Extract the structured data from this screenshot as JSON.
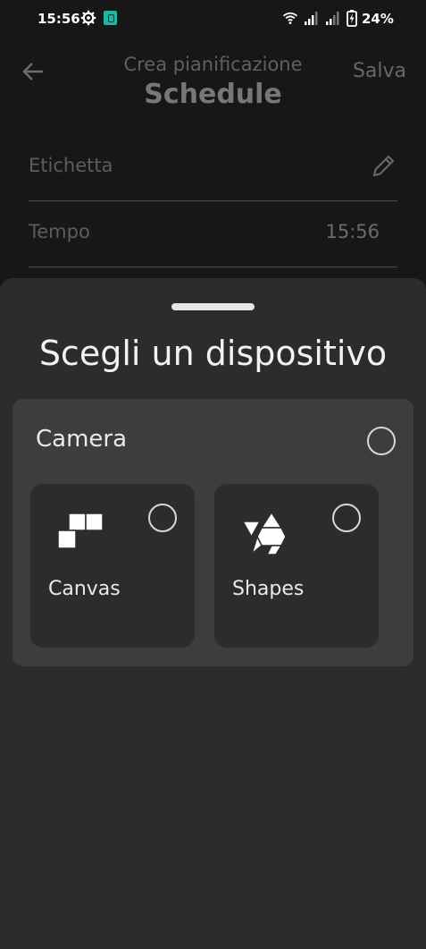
{
  "status_bar": {
    "time": "15:56",
    "battery": "24%",
    "icons": [
      "settings-gear-icon",
      "app-notification-icon",
      "wifi-icon",
      "signal-icon",
      "signal-icon",
      "battery-charging-icon"
    ]
  },
  "header": {
    "subtitle": "Crea pianificazione",
    "title": "Schedule",
    "save_label": "Salva",
    "back_icon": "arrow-left-icon"
  },
  "form": {
    "label_field": {
      "label": "Etichetta",
      "icon": "pencil-icon"
    },
    "time_field": {
      "label": "Tempo",
      "value": "15:56"
    }
  },
  "sheet": {
    "title": "Scegli un dispositivo",
    "group": {
      "label": "Camera",
      "selected": false,
      "devices": [
        {
          "label": "Canvas",
          "icon": "canvas-tiles-icon",
          "selected": false
        },
        {
          "label": "Shapes",
          "icon": "shapes-triangles-icon",
          "selected": false
        }
      ]
    }
  },
  "colors": {
    "background": "#171717",
    "sheet": "#2c2c2d",
    "group": "#3c3d3e",
    "text_primary": "#f2f2f2",
    "text_muted": "#5f6060"
  }
}
